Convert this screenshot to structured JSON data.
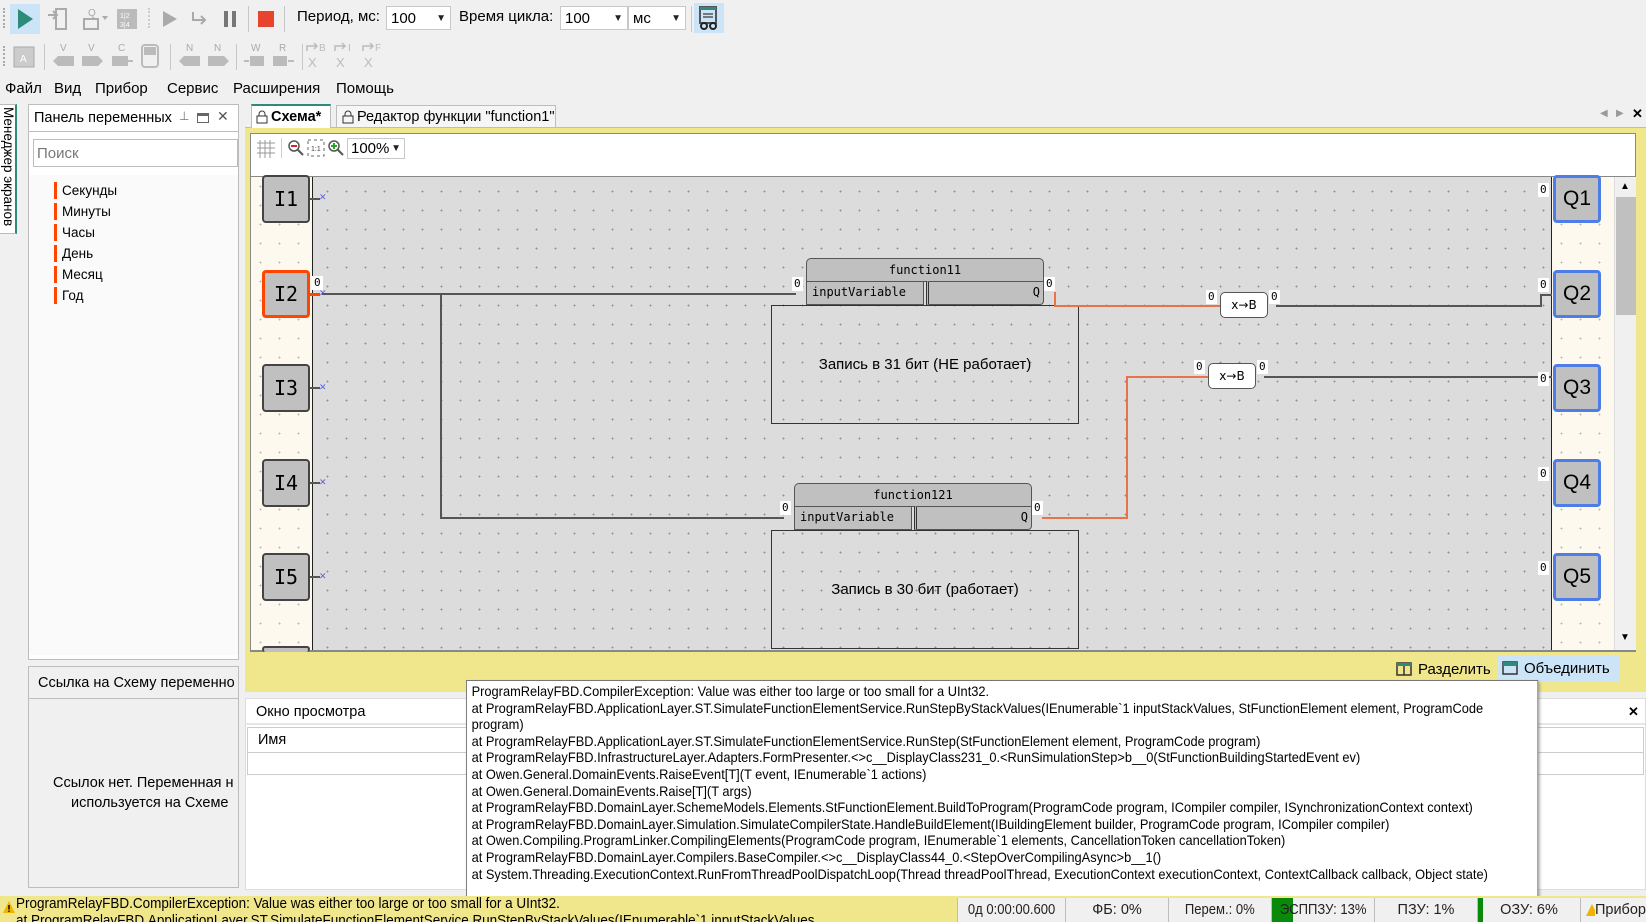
{
  "toolbar": {
    "run_icon": "play-icon",
    "period_label": "Период, мс:",
    "period_value": "100",
    "cycle_label": "Время цикла:",
    "cycle_value": "100",
    "cycle_unit": "мс",
    "row2_labels": [
      "V",
      "V",
      "C",
      "N",
      "N",
      "W",
      "R",
      "→B",
      "→I",
      "→F"
    ]
  },
  "menu": [
    "Файл",
    "Вид",
    "Прибор",
    "Сервис",
    "Расширения",
    "Помощь"
  ],
  "side_tab": "Менеджер экранов",
  "variables_panel": {
    "title": "Панель переменных",
    "search_placeholder": "Поиск",
    "items": [
      "Секунды",
      "Минуты",
      "Часы",
      "День",
      "Месяц",
      "Год"
    ]
  },
  "references_panel": {
    "title": "Ссылка на Схему переменно",
    "empty_text_line1": "Ссылок нет. Переменная н",
    "empty_text_line2": "используется на Схеме"
  },
  "tabs": [
    {
      "label": "Схема*",
      "active": true
    },
    {
      "label": "Редактор функции \"function1\"",
      "active": false
    }
  ],
  "scheme_toolbar": {
    "zoom": "100%"
  },
  "scheme": {
    "inputs": [
      "I1",
      "I2",
      "I3",
      "I4",
      "I5"
    ],
    "outputs": [
      "Q1",
      "Q2",
      "Q3",
      "Q4",
      "Q5"
    ],
    "port_value": "0",
    "functions": [
      {
        "name": "function11",
        "input": "inputVariable",
        "output": "Q",
        "note": "Запись в 31 бит (НЕ работает)"
      },
      {
        "name": "function121",
        "input": "inputVariable",
        "output": "Q",
        "note": "Запись в 30 бит (работает)"
      }
    ],
    "converter_label": "x→B"
  },
  "split_bar": {
    "split_label": "Разделить",
    "merge_label": "Объединить"
  },
  "watch_window": {
    "title": "Окно просмотра",
    "column_name": "Имя"
  },
  "tooltip": {
    "lines": [
      "ProgramRelayFBD.CompilerException: Value was either too large or too small for a UInt32.",
      "at ProgramRelayFBD.ApplicationLayer.ST.SimulateFunctionElementService.RunStepByStackValues(IEnumerable`1 inputStackValues, StFunctionElement element, ProgramCode program)",
      "at ProgramRelayFBD.ApplicationLayer.ST.SimulateFunctionElementService.RunStep(StFunctionElement element, ProgramCode program)",
      "at ProgramRelayFBD.InfrastructureLayer.Adapters.FormPresenter.<>c__DisplayClass231_0.<RunSimulationStep>b__0(StFunctionBuildingStartedEvent ev)",
      "at Owen.General.DomainEvents.RaiseEvent[T](T event, IEnumerable`1 actions)",
      "at Owen.General.DomainEvents.Raise[T](T args)",
      "at ProgramRelayFBD.DomainLayer.SchemeModels.Elements.StFunctionElement.BuildToProgram(ProgramCode program, ICompiler compiler, ISynchronizationContext context)",
      "at ProgramRelayFBD.DomainLayer.Simulation.SimulateCompilerState.HandleBuildElement(IBuildingElement builder, ProgramCode program, ICompiler compiler)",
      "at Owen.Compiling.ProgramLinker.CompilingElements(ProgramCode program, IEnumerable`1 elements, CancellationToken cancellationToken)",
      "at ProgramRelayFBD.DomainLayer.Compilers.BaseCompiler.<>c__DisplayClass44_0.<StepOverCompilingAsync>b__1()",
      "at System.Threading.ExecutionContext.RunFromThreadPoolDispatchLoop(Thread threadPoolThread, ExecutionContext executionContext, ContextCallback callback, Object state)"
    ]
  },
  "status_bar": {
    "error_line1": "ProgramRelayFBD.CompilerException: Value was either too large or too small for a UInt32.",
    "error_line2": "at ProgramRelayFBD.ApplicationLayer.ST.SimulateFunctionElementService.RunStepByStackValues(IEnumerable`1 inputStackValues",
    "time": "0д 0:00:00.600",
    "fb": "ФБ: 0%",
    "vars": "Перем.: 0%",
    "eeprom": "ЭСППЗУ: 13%",
    "rom": "ПЗУ: 1%",
    "ram": "ОЗУ: 6%",
    "device": "Прибор",
    "eeprom_fill": 0.13,
    "ram_fill": 0.06
  },
  "colors": {
    "accent": "#2e8b7a",
    "error": "#ff4500",
    "output_border": "#4f7de8",
    "wire_active": "#e8734a",
    "warning_bg": "#f0e68c"
  }
}
